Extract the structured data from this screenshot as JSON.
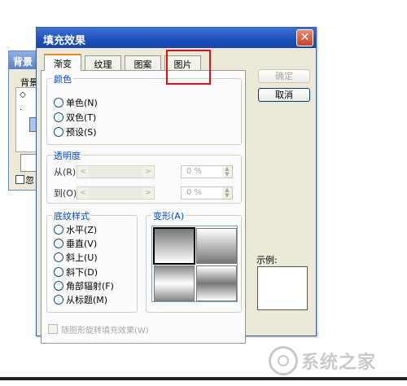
{
  "background_dialog": {
    "title": "背景",
    "group_label": "背景",
    "symbol_1": "◇",
    "symbol_2": "·",
    "checkbox_label": "忽"
  },
  "dialog": {
    "title": "填充效果",
    "close_glyph": "✕",
    "tabs": [
      {
        "label": "渐变"
      },
      {
        "label": "纹理"
      },
      {
        "label": "图案"
      },
      {
        "label": "图片"
      }
    ],
    "color_group": {
      "label": "颜色",
      "options": [
        "单色(N)",
        "双色(T)",
        "预设(S)"
      ]
    },
    "transparency_group": {
      "label": "透明度",
      "from_label": "从(R):",
      "to_label": "到(O):",
      "from_value": "0 %",
      "to_value": "0 %",
      "arrow_left": "<",
      "arrow_right": ">",
      "spin_up": "▲",
      "spin_down": "▼"
    },
    "shading_group": {
      "label": "底纹样式",
      "options": [
        "水平(Z)",
        "垂直(V)",
        "斜上(U)",
        "斜下(D)",
        "角部辐射(F)",
        "从标题(M)"
      ]
    },
    "variants_group": {
      "label": "变形(A)"
    },
    "rotate_checkbox_label": "随图形旋转填充效果(W)",
    "ok_label": "确定",
    "cancel_label": "取消",
    "sample_label": "示例:"
  },
  "watermark": {
    "text": "系统之家"
  }
}
